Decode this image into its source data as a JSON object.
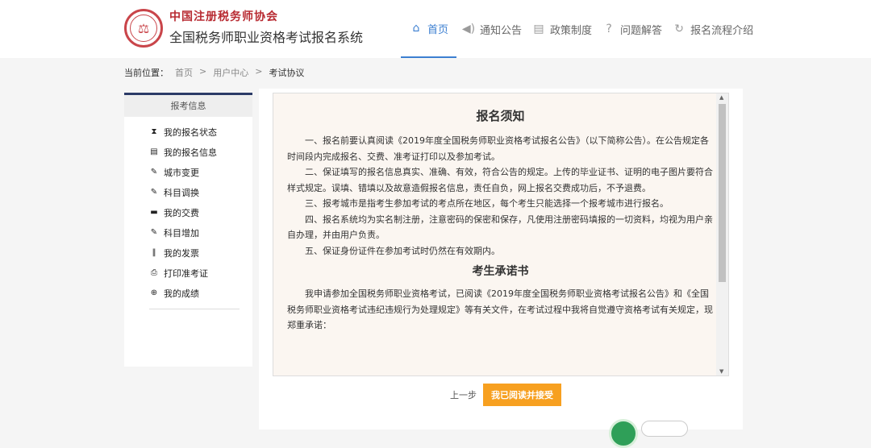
{
  "header": {
    "org_name": "中国注册税务师协会",
    "system_title": "全国税务师职业资格考试报名系统",
    "logo_icon": "seal-logo",
    "nav": [
      {
        "label": "首页",
        "icon": "home-icon",
        "active": true
      },
      {
        "label": "通知公告",
        "icon": "speaker-icon",
        "active": false
      },
      {
        "label": "政策制度",
        "icon": "document-icon",
        "active": false
      },
      {
        "label": "问题解答",
        "icon": "question-icon",
        "active": false
      },
      {
        "label": "报名流程介绍",
        "icon": "flow-icon",
        "active": false
      }
    ]
  },
  "breadcrumb": {
    "prefix": "当前位置：",
    "items": [
      "首页",
      "用户中心",
      "考试协议"
    ],
    "separator": ">"
  },
  "sidebar": {
    "title": "报考信息",
    "items": [
      {
        "label": "我的报名状态",
        "icon": "hourglass-icon"
      },
      {
        "label": "我的报名信息",
        "icon": "list-icon"
      },
      {
        "label": "城市变更",
        "icon": "edit-icon"
      },
      {
        "label": "科目调换",
        "icon": "edit-icon"
      },
      {
        "label": "我的交费",
        "icon": "card-icon"
      },
      {
        "label": "科目增加",
        "icon": "edit-icon"
      },
      {
        "label": "我的发票",
        "icon": "barcode-icon"
      },
      {
        "label": "打印准考证",
        "icon": "printer-icon"
      },
      {
        "label": "我的成绩",
        "icon": "magnifier-icon"
      }
    ]
  },
  "notice": {
    "title": "报名须知",
    "paragraphs": [
      "一、报名前要认真阅读《2019年度全国税务师职业资格考试报名公告》（以下简称公告）。在公告规定各时间段内完成报名、交费、准考证打印以及参加考试。",
      "二、保证填写的报名信息真实、准确、有效，符合公告的规定。上传的毕业证书、证明的电子图片要符合样式规定。误填、错填以及故意造假报名信息，责任自负，网上报名交费成功后，不予退费。",
      "三、报考城市是指考生参加考试的考点所在地区，每个考生只能选择一个报考城市进行报名。",
      "四、报名系统均为实名制注册，注意密码的保密和保存，凡使用注册密码填报的一切资料，均视为用户亲自办理，并由用户负责。",
      "五、保证身份证件在参加考试时仍然在有效期内。"
    ],
    "pledge_title": "考生承诺书",
    "pledge_text": "我申请参加全国税务师职业资格考试，已阅读《2019年度全国税务师职业资格考试报名公告》和《全国税务师职业资格考试违纪违规行为处理规定》等有关文件，在考试过程中我将自觉遵守资格考试有关规定，现郑重承诺："
  },
  "actions": {
    "prev": "上一步",
    "accept": "我已阅读并接受"
  },
  "colors": {
    "accent": "#3c7fd1",
    "button": "#f7a020",
    "brand": "#b82b32",
    "sidebar_top": "#2b3a67"
  }
}
